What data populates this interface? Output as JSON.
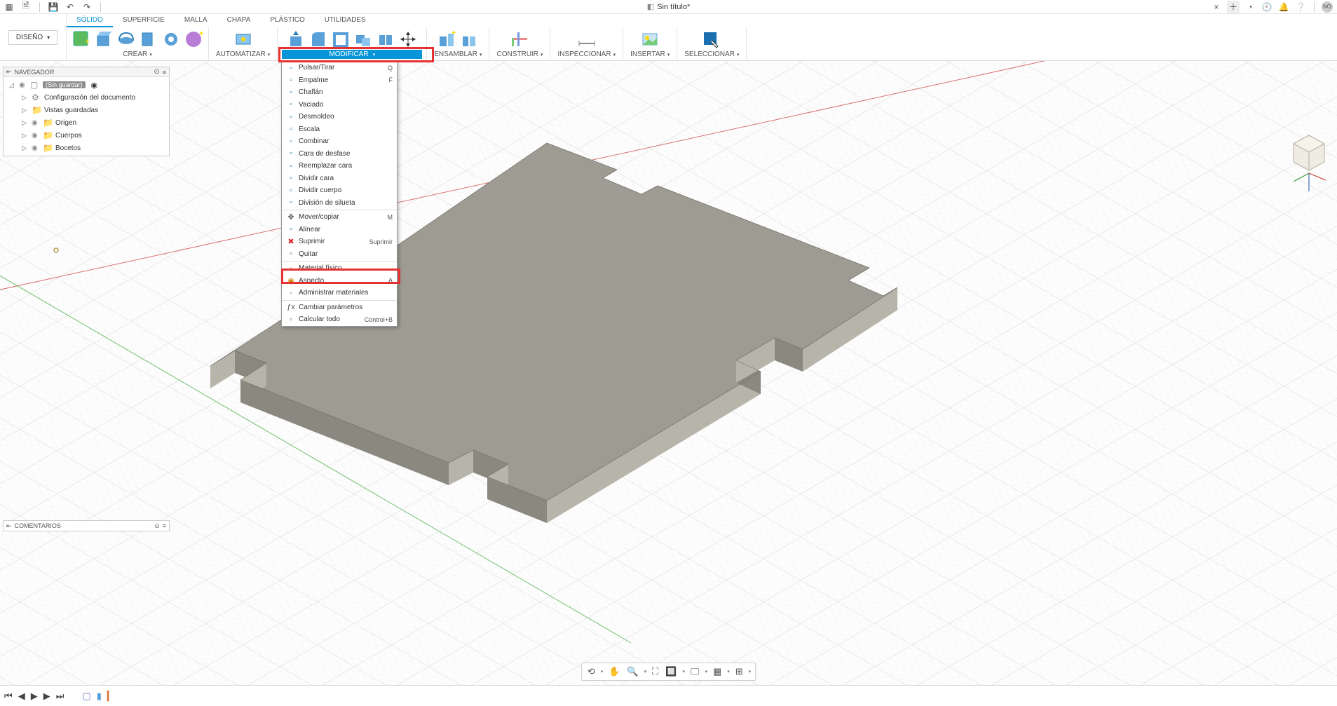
{
  "title": "Sin título*",
  "design_button": "DISEÑO",
  "tabs": [
    "SÓLIDO",
    "SUPERFICIE",
    "MALLA",
    "CHAPA",
    "PLÁSTICO",
    "UTILIDADES"
  ],
  "tool_groups": {
    "crear": "CREAR",
    "automatizar": "AUTOMATIZAR",
    "modificar": "MODIFICAR",
    "ensamblar": "ENSAMBLAR",
    "construir": "CONSTRUIR",
    "inspeccionar": "INSPECCIONAR",
    "insertar": "INSERTAR",
    "seleccionar": "SELECCIONAR"
  },
  "browser": {
    "title": "NAVEGADOR",
    "root": "(Sin guardar)",
    "items": [
      "Configuración del documento",
      "Vistas guardadas",
      "Origen",
      "Cuerpos",
      "Bocetos"
    ]
  },
  "comments": "COMENTARIOS",
  "dropdown": [
    {
      "label": "Pulsar/Tirar",
      "shortcut": "Q",
      "color": "#2a7fb8"
    },
    {
      "label": "Empalme",
      "shortcut": "F",
      "color": "#2a7fb8"
    },
    {
      "label": "Chaflán",
      "shortcut": "",
      "color": "#2a7fb8"
    },
    {
      "label": "Vaciado",
      "shortcut": "",
      "color": "#2a7fb8"
    },
    {
      "label": "Desmoldeo",
      "shortcut": "",
      "color": "#2a7fb8"
    },
    {
      "label": "Escala",
      "shortcut": "",
      "color": "#2a7fb8"
    },
    {
      "label": "Combinar",
      "shortcut": "",
      "color": "#2a7fb8"
    },
    {
      "label": "Cara de desfase",
      "shortcut": "",
      "color": "#2a7fb8"
    },
    {
      "label": "Reemplazar cara",
      "shortcut": "",
      "color": "#2a7fb8"
    },
    {
      "label": "Dividir cara",
      "shortcut": "",
      "color": "#2a7fb8"
    },
    {
      "label": "Dividir cuerpo",
      "shortcut": "",
      "color": "#2a7fb8"
    },
    {
      "label": "División de silueta",
      "shortcut": "",
      "color": "#2a7fb8"
    },
    {
      "sep": true
    },
    {
      "label": "Mover/copiar",
      "shortcut": "M",
      "color": "#555"
    },
    {
      "label": "Alinear",
      "shortcut": "",
      "color": "#2a7fb8"
    },
    {
      "label": "Suprimir",
      "shortcut": "Suprimir",
      "color": "#d22"
    },
    {
      "label": "Quitar",
      "shortcut": "",
      "color": "#555"
    },
    {
      "sep": true
    },
    {
      "label": "Material físico",
      "shortcut": "",
      "color": "#888"
    },
    {
      "label": "Aspecto",
      "shortcut": "A",
      "color": "#d08000",
      "hl": true
    },
    {
      "label": "Administrar materiales",
      "shortcut": "",
      "color": "#888"
    },
    {
      "sep": true
    },
    {
      "label": "Cambiar parámetros",
      "shortcut": "",
      "color": "#555",
      "fx": true
    },
    {
      "label": "Calcular todo",
      "shortcut": "Control+B",
      "color": "#555"
    }
  ]
}
